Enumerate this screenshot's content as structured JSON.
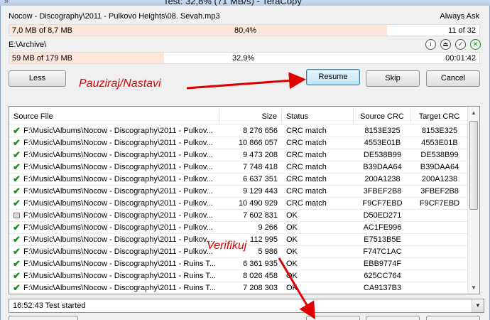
{
  "window": {
    "title": "Test: 32,8% (71 MB/s) - TeraCopy"
  },
  "current_file": {
    "path": "Nocow - Discography\\2011 - Pulkovo Heights\\08. Sevah.mp3",
    "action": "Always Ask",
    "progress_text": "7,0 MB of 8,7 MB",
    "percent_text": "80,4%",
    "percent": 80.4,
    "count": "11 of 32"
  },
  "total": {
    "target": "E:\\Archive\\",
    "progress_text": "59 MB of 179 MB",
    "percent_text": "32,9%",
    "percent": 32.9,
    "time": "00:01:42"
  },
  "buttons": {
    "less": "Less",
    "resume": "Resume",
    "skip": "Skip",
    "cancel": "Cancel"
  },
  "annotations": {
    "pause_resume": "Pauziraj/Nastavi",
    "verify": "Verifikuj"
  },
  "table": {
    "columns": [
      "Source File",
      "Size",
      "Status",
      "Source CRC",
      "Target CRC"
    ],
    "rows": [
      {
        "icon": "check",
        "file": "F:\\Music\\Albums\\Nocow - Discography\\2011 - Pulkov...",
        "size": "8 276 656",
        "status": "CRC match",
        "src": "8153E325",
        "tgt": "8153E325"
      },
      {
        "icon": "check",
        "file": "F:\\Music\\Albums\\Nocow - Discography\\2011 - Pulkov...",
        "size": "10 866 057",
        "status": "CRC match",
        "src": "4553E01B",
        "tgt": "4553E01B"
      },
      {
        "icon": "check",
        "file": "F:\\Music\\Albums\\Nocow - Discography\\2011 - Pulkov...",
        "size": "9 473 208",
        "status": "CRC match",
        "src": "DE538B99",
        "tgt": "DE538B99"
      },
      {
        "icon": "check",
        "file": "F:\\Music\\Albums\\Nocow - Discography\\2011 - Pulkov...",
        "size": "7 748 418",
        "status": "CRC match",
        "src": "B39DAA64",
        "tgt": "B39DAA64"
      },
      {
        "icon": "check",
        "file": "F:\\Music\\Albums\\Nocow - Discography\\2011 - Pulkov...",
        "size": "6 637 351",
        "status": "CRC match",
        "src": "200A1238",
        "tgt": "200A1238"
      },
      {
        "icon": "check",
        "file": "F:\\Music\\Albums\\Nocow - Discography\\2011 - Pulkov...",
        "size": "9 129 443",
        "status": "CRC match",
        "src": "3FBEF2B8",
        "tgt": "3FBEF2B8"
      },
      {
        "icon": "check",
        "file": "F:\\Music\\Albums\\Nocow - Discography\\2011 - Pulkov...",
        "size": "10 490 929",
        "status": "CRC match",
        "src": "F9CF7EBD",
        "tgt": "F9CF7EBD"
      },
      {
        "icon": "file",
        "file": "F:\\Music\\Albums\\Nocow - Discography\\2011 - Pulkov...",
        "size": "7 602 831",
        "status": "OK",
        "src": "D50ED271",
        "tgt": ""
      },
      {
        "icon": "check",
        "file": "F:\\Music\\Albums\\Nocow - Discography\\2011 - Pulkov...",
        "size": "9 266",
        "status": "OK",
        "src": "AC1FE996",
        "tgt": ""
      },
      {
        "icon": "check",
        "file": "F:\\Music\\Albums\\Nocow - Discography\\2011 - Pulkov...",
        "size": "112 995",
        "status": "OK",
        "src": "E7513B5E",
        "tgt": ""
      },
      {
        "icon": "check",
        "file": "F:\\Music\\Albums\\Nocow - Discography\\2011 - Pulkov...",
        "size": "5 986",
        "status": "OK",
        "src": "F747C1AC",
        "tgt": ""
      },
      {
        "icon": "check",
        "file": "F:\\Music\\Albums\\Nocow - Discography\\2011 - Ruins T...",
        "size": "6 361 935",
        "status": "OK",
        "src": "EBB9774F",
        "tgt": ""
      },
      {
        "icon": "check",
        "file": "F:\\Music\\Albums\\Nocow - Discography\\2011 - Ruins T...",
        "size": "8 026 458",
        "status": "OK",
        "src": "625CC764",
        "tgt": ""
      },
      {
        "icon": "check",
        "file": "F:\\Music\\Albums\\Nocow - Discography\\2011 - Ruins T...",
        "size": "7 208 303",
        "status": "OK",
        "src": "CA9137B3",
        "tgt": ""
      }
    ]
  },
  "log": {
    "text": "16:52:43 Test started"
  },
  "icons": {
    "info": "info-icon",
    "eject": "eject-icon",
    "verify": "check-circle-icon",
    "close": "close-icon"
  }
}
